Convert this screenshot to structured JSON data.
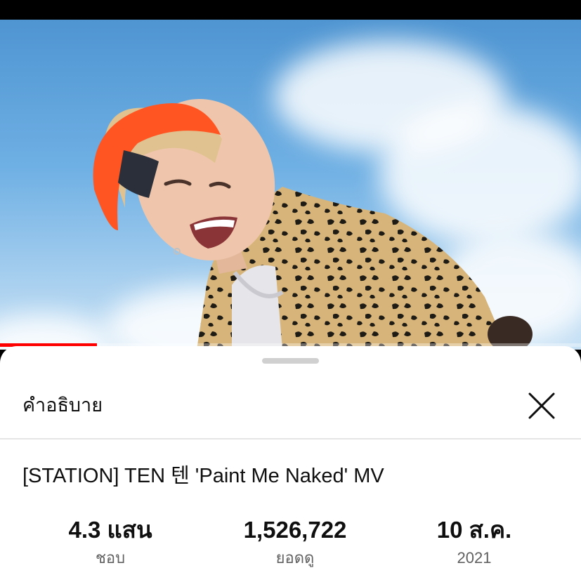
{
  "video": {
    "progress_fraction": 0.167
  },
  "description_panel": {
    "header_title": "คำอธิบาย",
    "close_icon": "close-icon",
    "video_title": "[STATION] TEN 텐 'Paint Me Naked' MV",
    "stats": {
      "likes": {
        "value": "4.3 แสน",
        "label": "ชอบ"
      },
      "views": {
        "value": "1,526,722",
        "label": "ยอดดู"
      },
      "date": {
        "value": "10 ส.ค.",
        "label": "2021"
      }
    }
  },
  "colors": {
    "progress": "#ff0000",
    "sheet_background": "#ffffff",
    "text_primary": "#0f0f0f",
    "text_secondary": "#606060"
  }
}
